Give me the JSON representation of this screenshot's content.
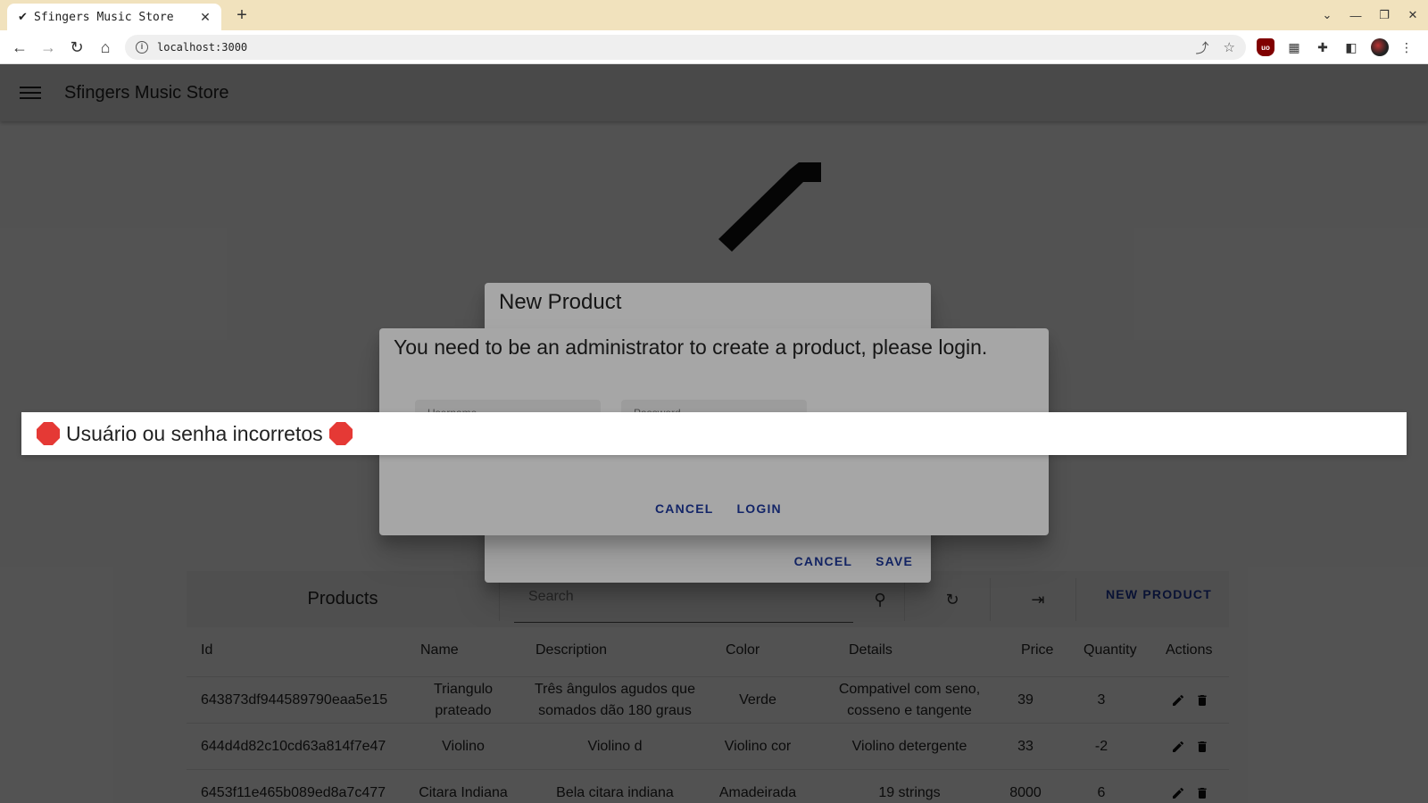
{
  "browser": {
    "tab_title": "Sfingers Music Store",
    "tab_favicon": "guitar-icon",
    "url": "localhost:3000"
  },
  "app": {
    "title": "Sfingers Music Store"
  },
  "products": {
    "title": "Products",
    "search_placeholder": "Search",
    "new_product_label": "NEW PRODUCT",
    "columns": [
      "Id",
      "Name",
      "Description",
      "Color",
      "Details",
      "Price",
      "Quantity",
      "Actions"
    ],
    "rows": [
      {
        "id": "643873df944589790eaa5e15",
        "name": "Triangulo prateado",
        "description": "Três ângulos agudos que somados dão 180 graus",
        "color": "Verde",
        "details": "Compativel com seno, cosseno e tangente",
        "price": "39",
        "quantity": "3"
      },
      {
        "id": "644d4d82c10cd63a814f7e47",
        "name": "Violino",
        "description": "Violino d",
        "color": "Violino cor",
        "details": "Violino detergente",
        "price": "33",
        "quantity": "-2"
      },
      {
        "id": "6453f11e465b089ed8a7c477",
        "name": "Citara Indiana",
        "description": "Bela citara indiana",
        "color": "Amadeirada",
        "details": "19 strings",
        "price": "8000",
        "quantity": "6"
      }
    ]
  },
  "new_product_dialog": {
    "title": "New Product",
    "cancel_label": "CANCEL",
    "save_label": "SAVE"
  },
  "login_dialog": {
    "title": "You need to be an administrator to create a product, please login.",
    "username_label": "Username",
    "password_label": "Password",
    "cancel_label": "CANCEL",
    "login_label": "LOGIN"
  },
  "toast": {
    "message": "Usuário ou senha incorretos",
    "icon": "stop-sign-icon",
    "icon_color": "#e53935"
  },
  "colors": {
    "accent": "#1e3aa0",
    "tab_strip": "#f1e2bd"
  }
}
